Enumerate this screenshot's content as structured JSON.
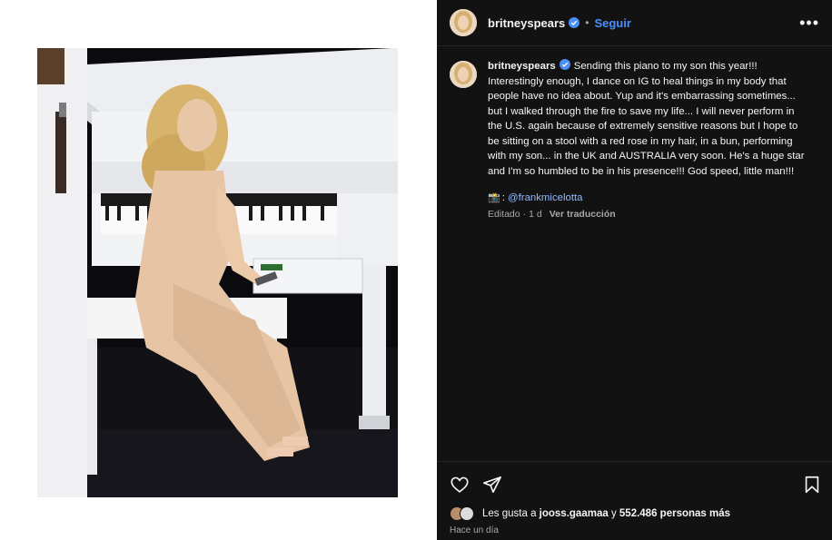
{
  "photo": {
    "subject": "photo-piano-performance"
  },
  "header": {
    "username": "britneyspears",
    "separator": "•",
    "follow_label": "Seguir",
    "more_label": "•••"
  },
  "caption": {
    "username": "britneyspears",
    "text": "Sending this piano to my son this year!!! Interestingly enough, I dance on IG to heal things in my body that people have no idea about. Yup and it's embarrassing sometimes... but I walked through the fire to save my life... I will never perform in the U.S. again because of extremely sensitive reasons but I hope to be sitting on a stool with a red rose in my hair, in a bun, performing with my son... in the UK and AUSTRALIA very soon. He's a huge star and I'm so humbled to be in his presence!!! God speed, little man!!!",
    "credit_emoji": "📸",
    "credit_sep": ":",
    "mention": "@frankmicelotta"
  },
  "meta": {
    "edited": "Editado",
    "sep": "·",
    "age": "1 d",
    "translate": "Ver traducción"
  },
  "likes": {
    "prefix": "Les gusta a",
    "user": "jooss.gaamaa",
    "conj": "y",
    "count": "552.486 personas más"
  },
  "time": "Hace un día",
  "colors": {
    "accent": "#4a8ff7",
    "mention": "#94b9ff",
    "background": "#121212",
    "muted": "#a8a8a8"
  },
  "icons": {
    "verified": "verified-badge-icon",
    "heart": "heart-icon",
    "share": "share-icon",
    "save": "bookmark-icon",
    "more": "more-options-icon"
  }
}
